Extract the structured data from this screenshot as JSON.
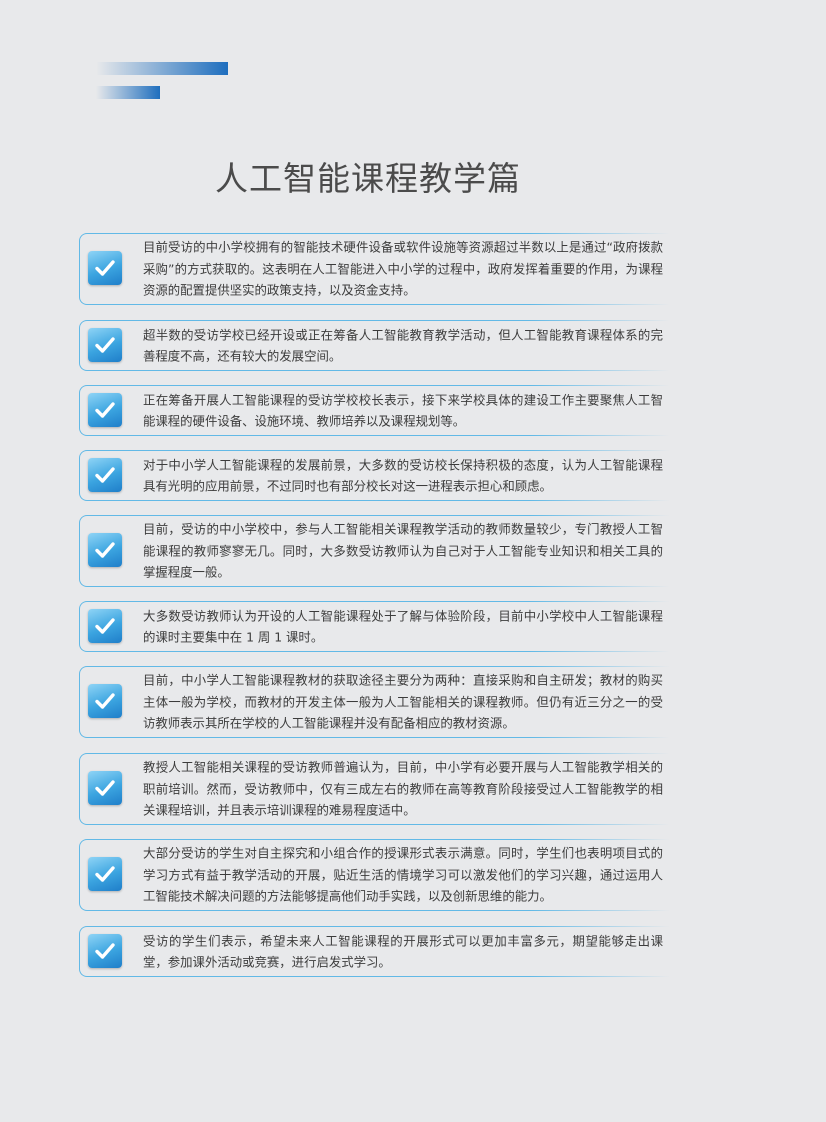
{
  "page": {
    "title": "人工智能课程教学篇",
    "accent_color": "#62b9e6",
    "brand_color": "#1e6ebe"
  },
  "items": [
    {
      "icon": "checkbox-checked-icon",
      "text": "目前受访的中小学校拥有的智能技术硬件设备或软件设施等资源超过半数以上是通过“政府拨款采购”的方式获取的。这表明在人工智能进入中小学的过程中，政府发挥着重要的作用，为课程资源的配置提供坚实的政策支持，以及资金支持。"
    },
    {
      "icon": "checkbox-checked-icon",
      "text": "超半数的受访学校已经开设或正在筹备人工智能教育教学活动，但人工智能教育课程体系的完善程度不高，还有较大的发展空间。"
    },
    {
      "icon": "checkbox-checked-icon",
      "text": "正在筹备开展人工智能课程的受访学校校长表示，接下来学校具体的建设工作主要聚焦人工智能课程的硬件设备、设施环境、教师培养以及课程规划等。"
    },
    {
      "icon": "checkbox-checked-icon",
      "text": "对于中小学人工智能课程的发展前景，大多数的受访校长保持积极的态度，认为人工智能课程具有光明的应用前景，不过同时也有部分校长对这一进程表示担心和顾虑。"
    },
    {
      "icon": "checkbox-checked-icon",
      "text": "目前，受访的中小学校中，参与人工智能相关课程教学活动的教师数量较少，专门教授人工智能课程的教师寥寥无几。同时，大多数受访教师认为自己对于人工智能专业知识和相关工具的掌握程度一般。"
    },
    {
      "icon": "checkbox-checked-icon",
      "text": "大多数受访教师认为开设的人工智能课程处于了解与体验阶段，目前中小学校中人工智能课程的课时主要集中在 1 周 1 课时。"
    },
    {
      "icon": "checkbox-checked-icon",
      "text": "目前，中小学人工智能课程教材的获取途径主要分为两种：直接采购和自主研发；教材的购买主体一般为学校，而教材的开发主体一般为人工智能相关的课程教师。但仍有近三分之一的受访教师表示其所在学校的人工智能课程并没有配备相应的教材资源。"
    },
    {
      "icon": "checkbox-checked-icon",
      "text": "教授人工智能相关课程的受访教师普遍认为，目前，中小学有必要开展与人工智能教学相关的职前培训。然而，受访教师中，仅有三成左右的教师在高等教育阶段接受过人工智能教学的相关课程培训，并且表示培训课程的难易程度适中。"
    },
    {
      "icon": "checkbox-checked-icon",
      "text": "大部分受访的学生对自主探究和小组合作的授课形式表示满意。同时，学生们也表明项目式的学习方式有益于教学活动的开展，贴近生活的情境学习可以激发他们的学习兴趣，通过运用人工智能技术解决问题的方法能够提高他们动手实践，以及创新思维的能力。"
    },
    {
      "icon": "checkbox-checked-icon",
      "text": "受访的学生们表示，希望未来人工智能课程的开展形式可以更加丰富多元，期望能够走出课堂，参加课外活动或竞赛，进行启发式学习。"
    }
  ]
}
